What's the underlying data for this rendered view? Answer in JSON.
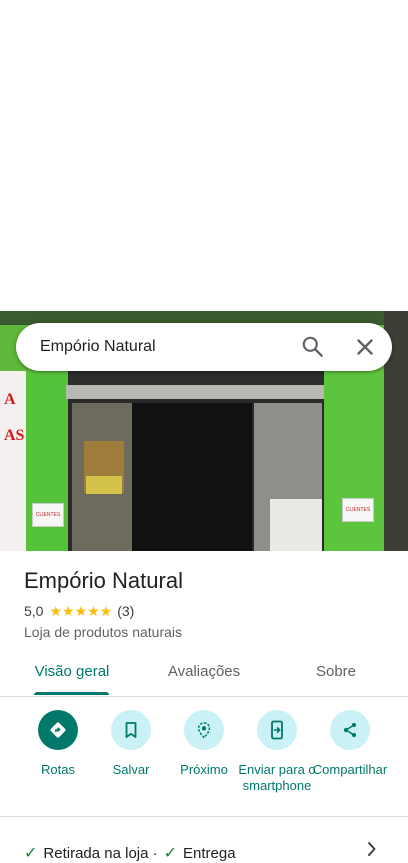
{
  "search": {
    "query": "Empório Natural"
  },
  "place": {
    "name": "Empório Natural",
    "rating": "5,0",
    "stars": "★★★★★",
    "review_count": "(3)",
    "category": "Loja de produtos naturais"
  },
  "tabs": [
    {
      "label": "Visão geral",
      "active": true
    },
    {
      "label": "Avaliações",
      "active": false
    },
    {
      "label": "Sobre",
      "active": false
    }
  ],
  "actions": [
    {
      "label": "Rotas",
      "icon": "directions-icon"
    },
    {
      "label": "Salvar",
      "icon": "bookmark-icon"
    },
    {
      "label": "Próximo",
      "icon": "nearby-icon"
    },
    {
      "label": "Enviar para o smartphone",
      "icon": "send-to-phone-icon"
    },
    {
      "label": "Compartilhar",
      "icon": "share-icon"
    }
  ],
  "services": [
    {
      "label": "Retirada na loja ·"
    },
    {
      "label": "Entrega"
    }
  ],
  "photo_sign_left": "CLIENTES",
  "photo_sign_right": "CLIENTES",
  "photo_wall_letters": [
    "A",
    "AS"
  ],
  "colors": {
    "accent": "#00796b",
    "action_bg": "#c9f1f6",
    "star": "#fbbc04",
    "check": "#188038"
  }
}
